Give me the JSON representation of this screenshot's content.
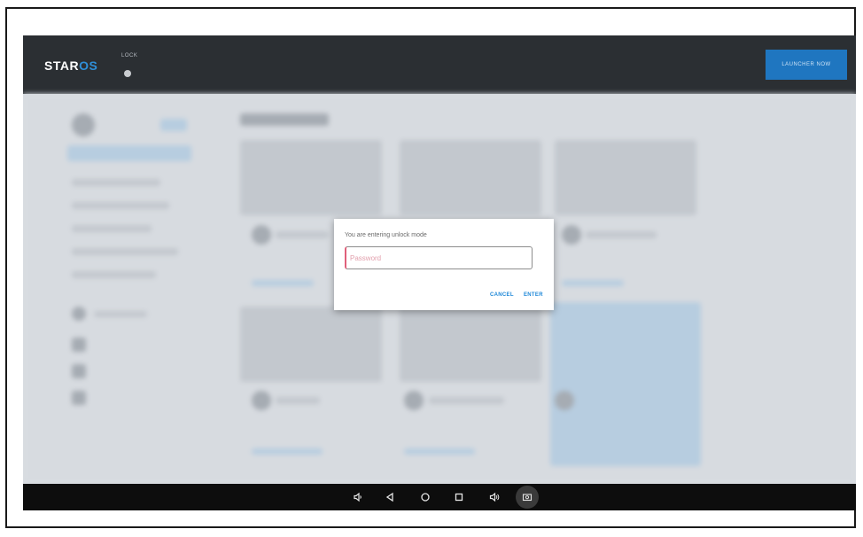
{
  "topbar": {
    "logo_part1": "STAR",
    "logo_part2": "OS",
    "lock_label": "LOCK",
    "launcher_button": "LAUNCHER NOW"
  },
  "dialog": {
    "message": "You are entering unlock mode",
    "password_placeholder": "Password",
    "password_value": "",
    "cancel_label": "CANCEL",
    "enter_label": "ENTER"
  },
  "navbar": {
    "icons": [
      "volume-down-icon",
      "back-icon",
      "home-icon",
      "recents-icon",
      "volume-up-icon",
      "screenshot-icon"
    ]
  },
  "colors": {
    "topbar_bg": "#2b2f33",
    "accent": "#1f76c0",
    "link": "#1e88d8",
    "navbar_bg": "#0d0d0d"
  }
}
